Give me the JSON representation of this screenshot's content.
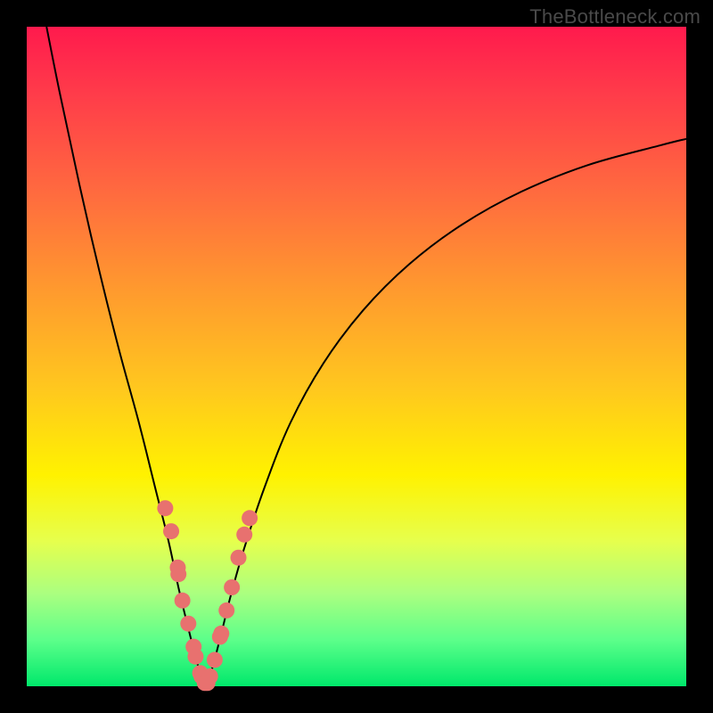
{
  "watermark": "TheBottleneck.com",
  "colors": {
    "curve_stroke": "#000000",
    "dot_fill": "#e8716f",
    "frame_bg": "#000000"
  },
  "chart_data": {
    "type": "line",
    "title": "",
    "xlabel": "",
    "ylabel": "",
    "xlim": [
      0,
      100
    ],
    "ylim": [
      0,
      100
    ],
    "series": [
      {
        "name": "left-curve",
        "x": [
          3,
          5,
          8,
          11,
          14,
          17,
          19.5,
          21.5,
          23,
          24.2,
          25.2,
          26,
          26.7,
          27.2
        ],
        "y": [
          100,
          90,
          76,
          63,
          51,
          40,
          30,
          22,
          15,
          10,
          6,
          3,
          1,
          0
        ]
      },
      {
        "name": "right-curve",
        "x": [
          27.2,
          28.2,
          29.5,
          31,
          33,
          36,
          40,
          45,
          51,
          58,
          66,
          75,
          85,
          96,
          100
        ],
        "y": [
          0,
          3,
          8,
          14,
          21,
          30,
          40,
          49,
          57,
          64,
          70,
          75,
          79,
          82,
          83
        ]
      }
    ],
    "dots_left": {
      "name": "left-dots",
      "x": [
        21.0,
        21.9,
        22.9,
        23.0,
        23.6,
        24.5,
        25.3,
        25.6,
        26.3,
        26.5,
        27.0
      ],
      "y": [
        27.0,
        23.5,
        18.0,
        17.0,
        13.0,
        9.5,
        6.0,
        4.5,
        2.0,
        1.5,
        0.5
      ]
    },
    "dots_right": {
      "name": "right-dots",
      "x": [
        27.4,
        27.8,
        28.5,
        29.3,
        29.5,
        30.3,
        31.1,
        32.1,
        33.0,
        33.8
      ],
      "y": [
        0.5,
        1.5,
        4.0,
        7.5,
        8.0,
        11.5,
        15.0,
        19.5,
        23.0,
        25.5
      ]
    }
  }
}
